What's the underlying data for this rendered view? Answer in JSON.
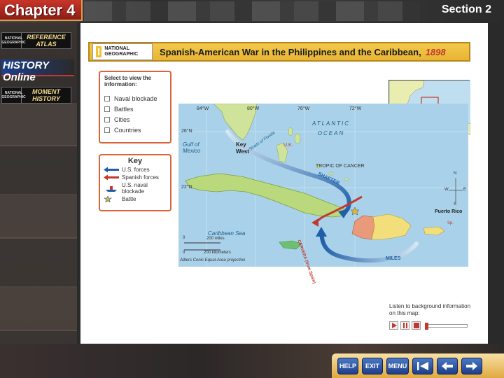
{
  "header": {
    "chapter": "Chapter 4",
    "section": "Section 2"
  },
  "sidebar": {
    "reference_atlas": "REFERENCE ATLAS",
    "history_online": "HISTORY Online",
    "moment_history": "MOMENT HISTORY",
    "ng_small": "NATIONAL GEOGRAPHIC"
  },
  "title": {
    "logo": "NATIONAL GEOGRAPHIC",
    "text": "Spanish-American War in the Philippines and the Caribbean,",
    "year": "1898"
  },
  "select_panel": {
    "title": "Select to view the information:",
    "options": [
      "Naval blockade",
      "Battles",
      "Cities",
      "Countries"
    ]
  },
  "key": {
    "title": "Key",
    "items": [
      "U.S. forces",
      "Spanish forces",
      "U.S. naval blockade",
      "Battle"
    ]
  },
  "map": {
    "gulf": "Gulf of Mexico",
    "key_west": "Key West",
    "florida_strait": "Straits of Florida",
    "atlantic": "ATLANTIC OCEAN",
    "tropic": "TROPIC OF CANCER",
    "shafter": "SHAFTER",
    "cervera": "CERVERA (from Spain)",
    "miles_route": "MILES",
    "caribbean": "Caribbean Sea",
    "puerto_rico": "Puerto Rico",
    "puerto_rico_sub": "Sp.",
    "uk": "U.K.",
    "lon_84": "84°W",
    "lon_80": "80°W",
    "lon_76": "76°W",
    "lon_72": "72°W",
    "lat_26": "26°N",
    "lat_22": "22°N",
    "scale_miles": "200 miles",
    "scale_km": "200 kilometers",
    "zero_top": "0",
    "zero_bottom": "0",
    "projection": "Albers Conic Equal-Area projection",
    "compass_n": "N",
    "compass_s": "S",
    "compass_e": "E",
    "compass_w": "W"
  },
  "audio": {
    "label": "Listen to background information on this map:"
  },
  "nav": {
    "help": "HELP",
    "exit": "EXIT",
    "menu": "MENU"
  },
  "colors": {
    "us_forces": "#1f5fa8",
    "spanish_forces": "#c0392b",
    "title_bar": "#efbf41",
    "panel_border": "#d9663a"
  }
}
